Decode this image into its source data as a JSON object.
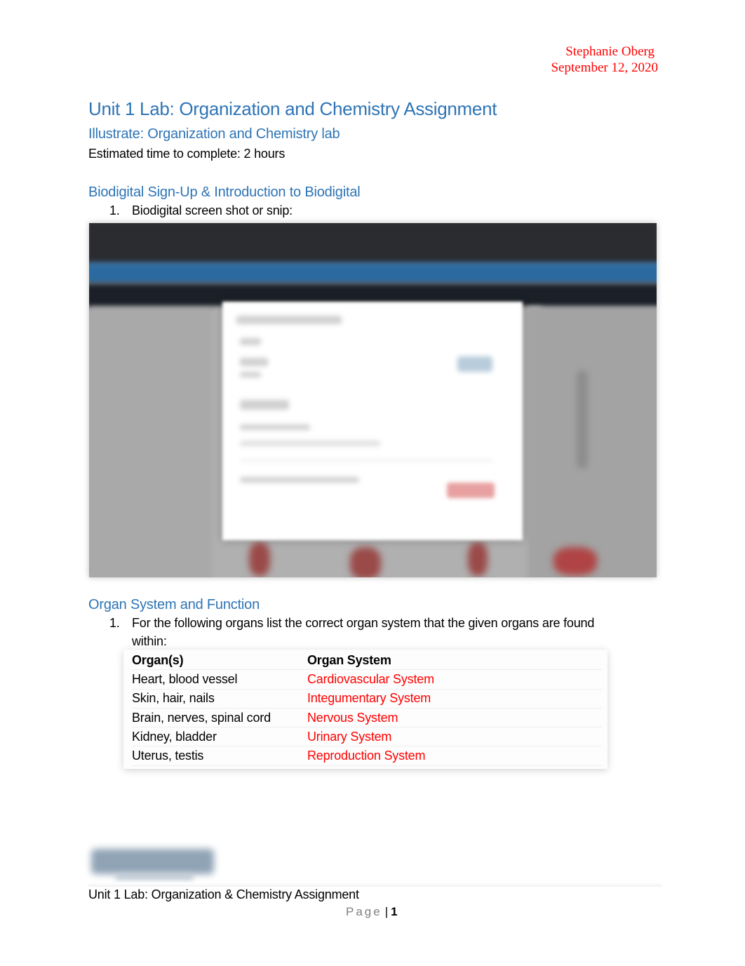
{
  "header": {
    "author": "Stephanie Oberg",
    "date": "September 12, 2020"
  },
  "title": "Unit 1 Lab: Organization and Chemistry Assignment",
  "subtitle": "Illustrate: Organization and Chemistry lab",
  "estimated_time": "Estimated time to complete: 2 hours",
  "sections": [
    {
      "heading": "Biodigital Sign-Up & Introduction to Biodigital",
      "items": [
        {
          "number": "1.",
          "text": "Biodigital screen shot or snip:"
        }
      ]
    },
    {
      "heading": "Organ System and Function",
      "items": [
        {
          "number": "1.",
          "text": "For the following organs list the correct organ system that the given organs are found",
          "text_cont": "within:"
        }
      ]
    }
  ],
  "organ_table": {
    "headers": [
      "Organ(s)",
      "Organ System"
    ],
    "rows": [
      {
        "organs": "Heart, blood vessel",
        "system": "Cardiovascular System"
      },
      {
        "organs": "Skin, hair, nails",
        "system": "Integumentary System"
      },
      {
        "organs": "Brain, nerves, spinal cord",
        "system": "Nervous System"
      },
      {
        "organs": "Kidney, bladder",
        "system": "Urinary System"
      },
      {
        "organs": "Uterus, testis",
        "system": "Reproduction System"
      }
    ]
  },
  "screenshot": {
    "description": "blurred-biodigital-signup-screenshot"
  },
  "colors": {
    "heading": "#2e74b5",
    "answer": "#ff0000",
    "author": "#ff0000"
  },
  "footer": {
    "title": "Unit 1 Lab: Organization & Chemistry Assignment",
    "page_label": "Page",
    "page_number": "1"
  }
}
